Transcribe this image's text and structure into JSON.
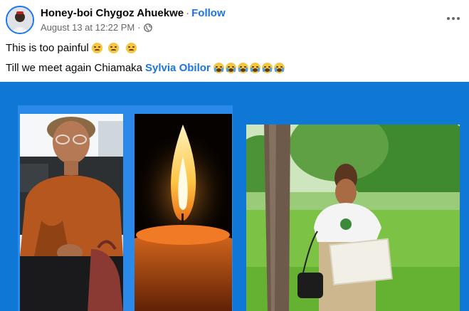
{
  "post": {
    "author": "Honey-boi Chygoz Ahuekwe",
    "separator": "·",
    "follow_label": "Follow",
    "timestamp": "August 13 at 12:22 PM",
    "meta_separator": "·",
    "audience_icon": "globe-icon",
    "more_icon": "more-options-icon",
    "line1_text": "This is too painful",
    "line1_emojis": [
      "persevering-face-emoji",
      "persevering-face-emoji",
      "persevering-face-emoji"
    ],
    "line2_text": "Till we meet again Chiamaka",
    "line2_mention": "Sylvia Obilor",
    "line2_emojis": [
      "loudly-crying-face-emoji",
      "loudly-crying-face-emoji",
      "loudly-crying-face-emoji",
      "loudly-crying-face-emoji",
      "loudly-crying-face-emoji",
      "loudly-crying-face-emoji"
    ]
  },
  "media": {
    "background_color": "#0f78d6",
    "photos": [
      "woman-portrait-photo",
      "candle-flame-photo",
      "nysc-graduate-photo"
    ]
  },
  "colors": {
    "link": "#1b74e4",
    "secondary_text": "#65676b",
    "primary_text": "#050505"
  }
}
